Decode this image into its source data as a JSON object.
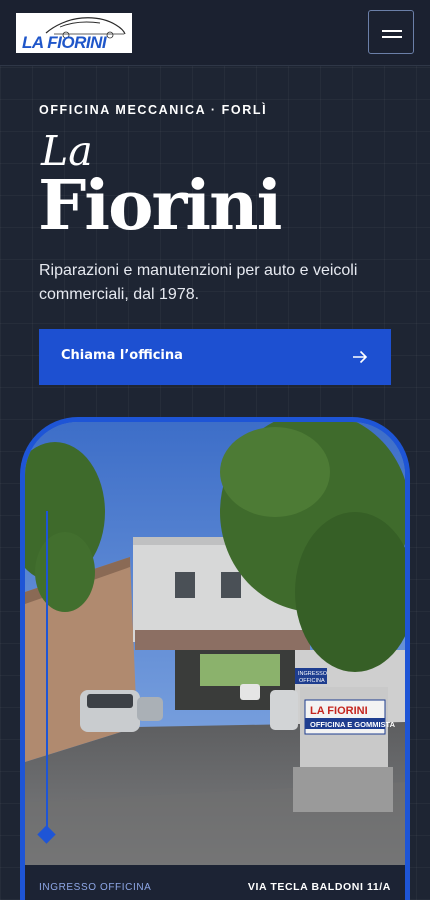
{
  "header": {
    "logo_text": "LA FIORINI",
    "logo_small": "s.n.c.",
    "menu_icon": "hamburger-icon"
  },
  "hero": {
    "eyebrow": "OFFICINA MECCANICA · FORLÌ",
    "title_la": "La",
    "title_main": "Fiorini",
    "subtitle": "Riparazioni e manutenzioni per auto e veicoli commerciali, dal 1978.",
    "cta_label": "Chiama l’officina",
    "cta_icon": "arrow-right-icon"
  },
  "photo": {
    "caption_left": "INGRESSO OFFICINA",
    "caption_right": "VIA TECLA BALDONI 11/A",
    "sign_title": "LA FIORINI",
    "sign_sub": "OFFICINA E GOMMISTA",
    "sign_ingresso_1": "INGRESSO",
    "sign_ingresso_2": "OFFICINA"
  },
  "colors": {
    "background": "#1e2533",
    "accent": "#1d50d1",
    "caption_accent": "#8ea7e6"
  }
}
